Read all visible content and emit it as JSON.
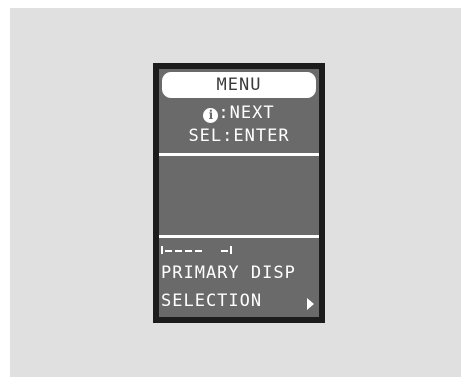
{
  "display": {
    "title": "MENU",
    "next_label": ":NEXT",
    "sel_label": "SEL:ENTER",
    "item_line1": "PRIMARY DISP",
    "item_line2": "SELECTION"
  },
  "icons": {
    "info": "info-icon",
    "more": "right-arrow-icon"
  },
  "colors": {
    "bezel": "#1c1c1c",
    "lcd_background": "#6a6a6a",
    "lcd_text": "#ffffff",
    "panel_background": "#e0e0e0"
  }
}
